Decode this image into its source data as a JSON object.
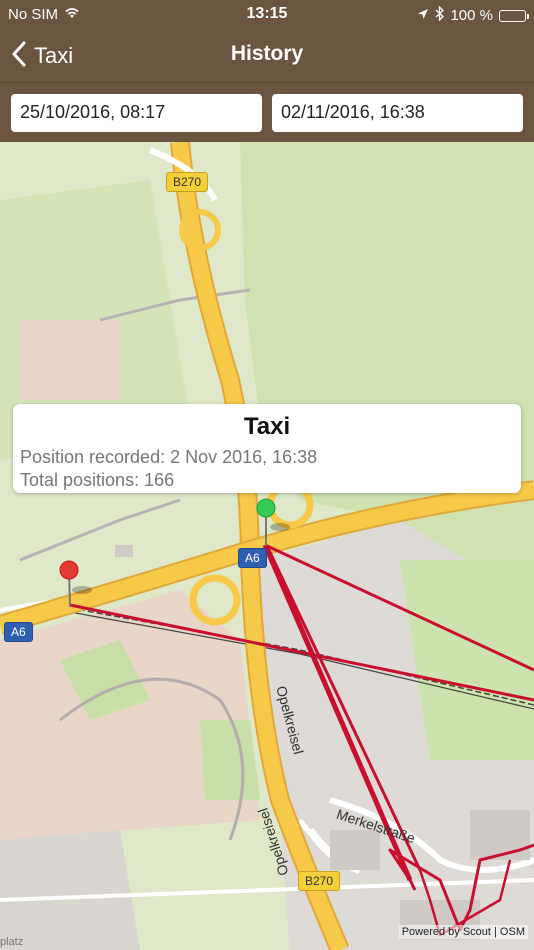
{
  "status": {
    "carrier": "No SIM",
    "time": "13:15",
    "battery_percent": "100 %",
    "battery_level": 1.0
  },
  "nav": {
    "back_label": "Taxi",
    "title": "History"
  },
  "dates": {
    "from": "25/10/2016, 08:17",
    "to": "02/11/2016, 16:38"
  },
  "callout": {
    "title": "Taxi",
    "position_recorded": "Position recorded: 2 Nov 2016, 16:38",
    "total_positions": "Total positions: 166"
  },
  "map": {
    "road_labels": [
      "B270",
      "A6",
      "A6",
      "B270"
    ],
    "street_labels": [
      "Opelkreisel",
      "Opelkreisel",
      "Merkelstraße"
    ],
    "attribution": "Powered by Scout | OSM",
    "corner_text": "platz"
  },
  "pins": {
    "start_color": "#e53935",
    "end_color": "#33cc55"
  },
  "colors": {
    "bar": "#6b5440",
    "route": "#c8102e",
    "motorway": "#f7c948"
  }
}
